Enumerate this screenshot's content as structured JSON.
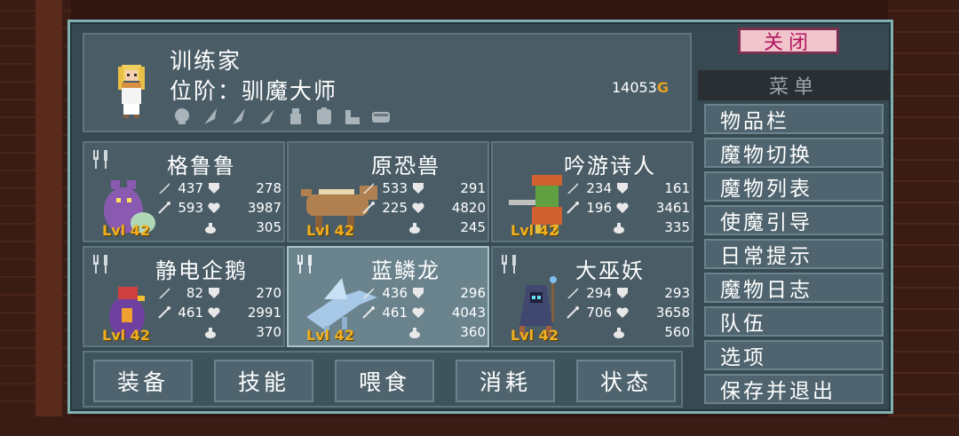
{
  "trainer": {
    "name": "训练家",
    "rank": "位阶：驯魔大师",
    "gold_amount": "14053",
    "gold_unit": "G",
    "badges": [
      "badge-1-icon",
      "badge-2-icon",
      "badge-3-icon",
      "badge-4-icon",
      "badge-5-icon",
      "badge-6-icon",
      "badge-7-icon",
      "badge-8-icon"
    ]
  },
  "monsters": [
    {
      "name": "格鲁鲁",
      "attack": "437",
      "defense": "278",
      "magic": "593",
      "health": "3987",
      "mana": "305",
      "level": "Lvl 42",
      "color": "#8a5ab0"
    },
    {
      "name": "原恐兽",
      "attack": "533",
      "defense": "291",
      "magic": "225",
      "health": "4820",
      "mana": "245",
      "level": "Lvl 42",
      "color": "#b08050"
    },
    {
      "name": "吟游诗人",
      "attack": "234",
      "defense": "161",
      "magic": "196",
      "health": "3461",
      "mana": "335",
      "level": "Lvl 42",
      "color": "#d06030"
    },
    {
      "name": "静电企鹅",
      "attack": "82",
      "defense": "270",
      "magic": "461",
      "health": "2991",
      "mana": "370",
      "level": "Lvl 42",
      "color": "#7040a0"
    },
    {
      "name": "蓝鳞龙",
      "attack": "436",
      "defense": "296",
      "magic": "461",
      "health": "4043",
      "mana": "360",
      "level": "Lvl 42",
      "color": "#a8c8e8"
    },
    {
      "name": "大巫妖",
      "attack": "294",
      "defense": "293",
      "magic": "706",
      "health": "3658",
      "mana": "560",
      "level": "Lvl 42",
      "color": "#404870"
    }
  ],
  "actions": [
    "装备",
    "技能",
    "喂食",
    "消耗",
    "状态"
  ],
  "menu": {
    "close_label": "关闭",
    "title": "菜单",
    "items": [
      "物品栏",
      "魔物切换",
      "魔物列表",
      "使魔引导",
      "日常提示",
      "魔物日志",
      "队伍",
      "选项",
      "保存并退出"
    ]
  },
  "colors": {
    "frame": "#7fb1b0",
    "panel": "#4a5d67",
    "level": "#f0b020",
    "gold": "#e8a020",
    "close_bg": "#f2c4cc",
    "close_text": "#b01860"
  }
}
